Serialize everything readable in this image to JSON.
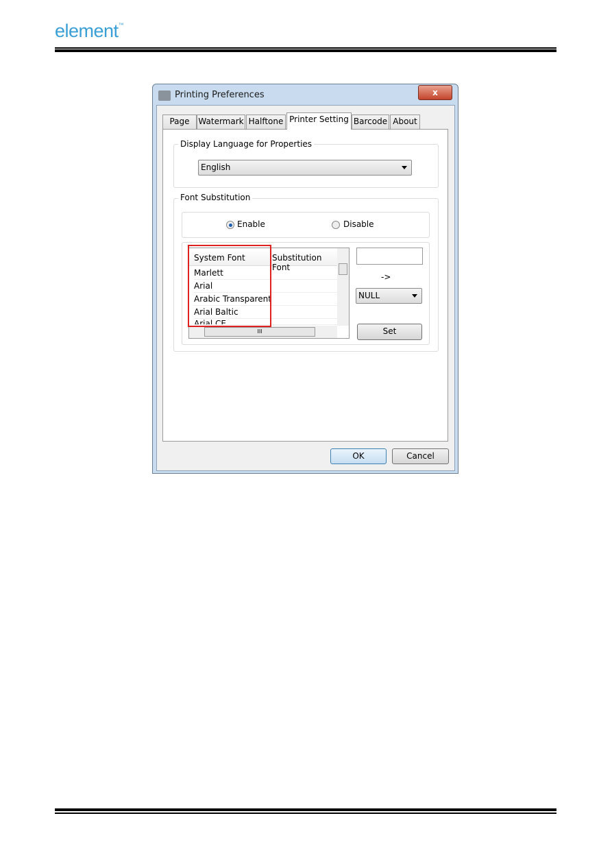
{
  "doc": {
    "logo": "element",
    "logo_tm": "™"
  },
  "dialog": {
    "title": "Printing Preferences",
    "close_label": "x",
    "tabs": [
      {
        "label": "Page"
      },
      {
        "label": "Watermark"
      },
      {
        "label": "Halftone"
      },
      {
        "label": "Printer Setting",
        "active": true
      },
      {
        "label": "Barcode"
      },
      {
        "label": "About"
      }
    ],
    "language_group": {
      "legend": "Display Language for Properties",
      "selected": "English"
    },
    "font_group": {
      "legend": "Font Substitution",
      "enable_label": "Enable",
      "disable_label": "Disable",
      "selected": "Enable",
      "columns": [
        "System Font",
        "Substitution Font"
      ],
      "rows": [
        "Marlett",
        "Arial",
        "Arabic Transparent",
        "Arial Baltic",
        "Arial CE"
      ],
      "hscroll_grip": "III",
      "text_value": "",
      "arrow_text": "->",
      "sub_selected": "NULL",
      "set_label": "Set"
    },
    "ok_label": "OK",
    "cancel_label": "Cancel"
  },
  "colors": {
    "logo": "#3a9fd6",
    "highlight": "#e0201f",
    "ok_border": "#3c7fb1"
  }
}
